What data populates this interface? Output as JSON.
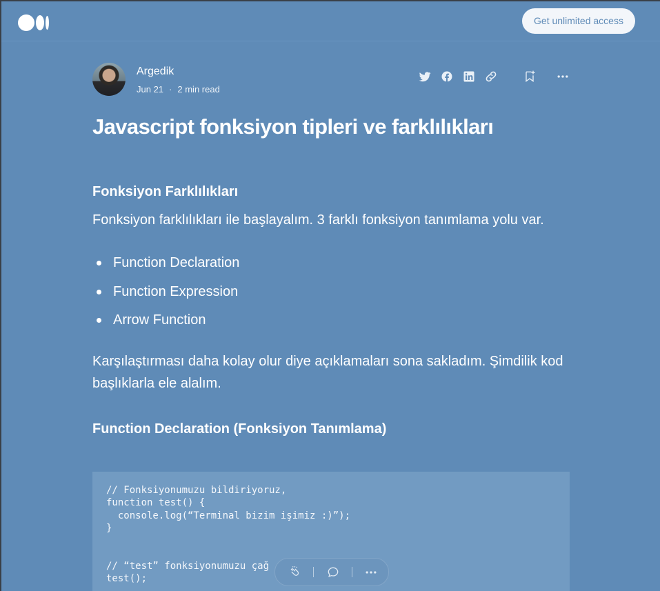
{
  "topbar": {
    "logo": "medium-logo",
    "cta_label": "Get unlimited access"
  },
  "author": {
    "name": "Argedik",
    "date": "Jun 21",
    "separator": "·",
    "read_time": "2 min read"
  },
  "share_icons": [
    "twitter-icon",
    "facebook-icon",
    "linkedin-icon",
    "link-icon",
    "bookmark-icon",
    "more-icon"
  ],
  "article": {
    "title": "Javascript fonksiyon tipleri ve farklılıkları",
    "section1_heading": "Fonksiyon Farklılıkları",
    "intro": "Fonksiyon farklılıkları ile başlayalım. 3 farklı fonksiyon tanımlama yolu var.",
    "list": [
      "Function Declaration",
      "Function Expression",
      "Arrow Function"
    ],
    "paragraph2": "Karşılaştırması daha kolay olur diye açıklamaları sona sakladım. Şimdilik kod başlıklarla ele alalım.",
    "section2_heading": "Function Declaration (Fonksiyon Tanımlama)",
    "code": "// Fonksiyonumuzu bildiriyoruz,\nfunction test() {\n  console.log(“Terminal bizim işimiz :)”);\n}\n\n\n// “test” fonksiyonumuzu çağ             lım…\ntest();"
  },
  "floating_bar": {
    "icons": [
      "clap-icon",
      "comment-icon",
      "more-icon"
    ]
  },
  "colors": {
    "background": "#5f8bb7",
    "code_background": "#729bc2",
    "cta_background": "#f3f6fa"
  }
}
